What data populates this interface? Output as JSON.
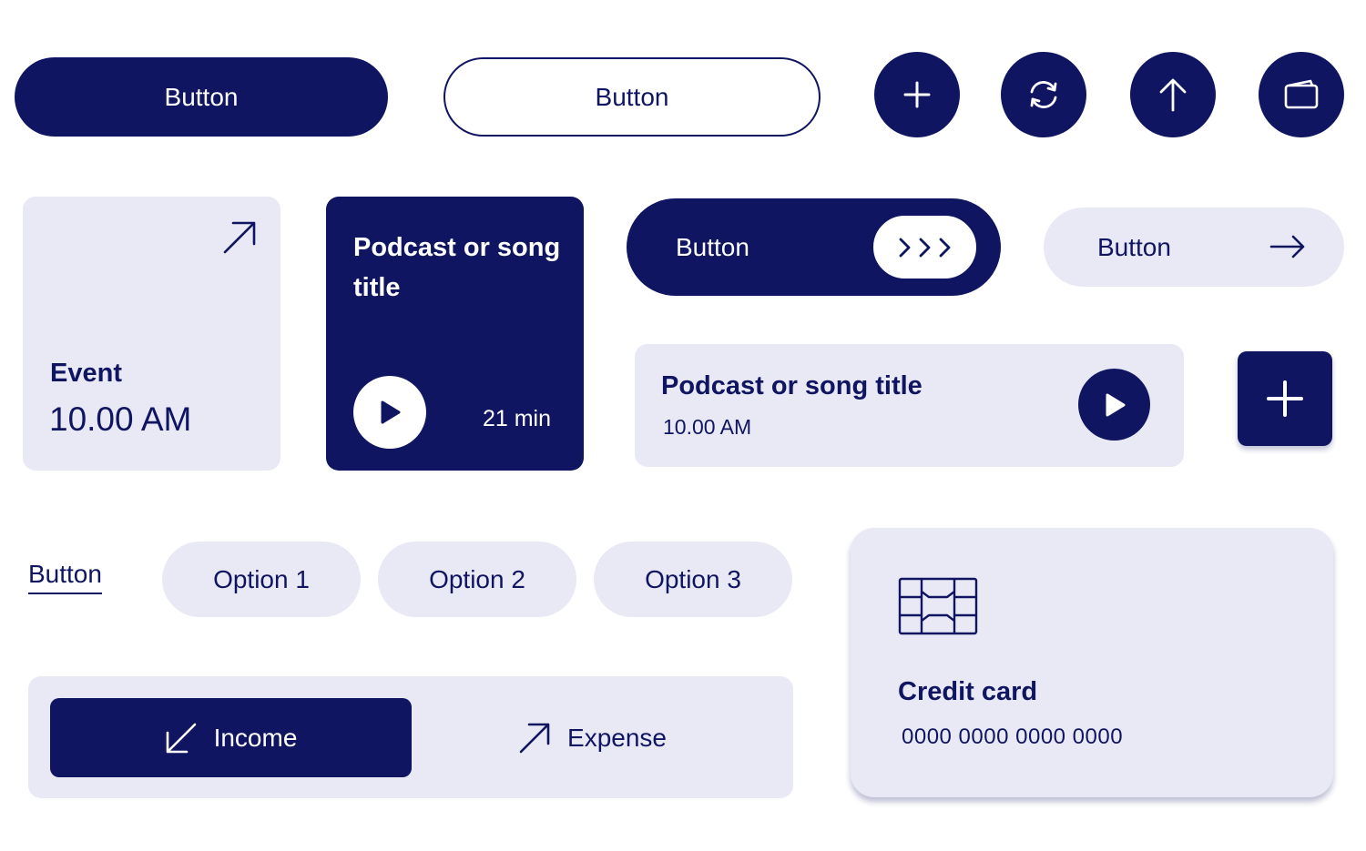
{
  "colors": {
    "primary": "#0f1560",
    "surface": "#e9e9f5",
    "white": "#ffffff"
  },
  "buttons": {
    "primary_label": "Button",
    "outline_label": "Button",
    "slide_label": "Button",
    "slide_handle": ">>>",
    "arrow_label": "Button",
    "text_link": "Button"
  },
  "icon_buttons": [
    "plus-icon",
    "refresh-icon",
    "arrow-up-icon",
    "wallet-icon"
  ],
  "event_card": {
    "label": "Event",
    "time": "10.00 AM",
    "icon": "arrow-up-right-icon"
  },
  "podcast_card": {
    "title": "Podcast or song title",
    "duration": "21 min",
    "icon": "play-icon"
  },
  "podcast_row": {
    "title": "Podcast or song title",
    "time": "10.00 AM",
    "icon": "play-icon"
  },
  "add_button": {
    "icon": "plus-icon"
  },
  "options": [
    "Option 1",
    "Option 2",
    "Option 3"
  ],
  "segmented": {
    "income": "Income",
    "expense": "Expense",
    "selected": "income"
  },
  "credit_card": {
    "title": "Credit card",
    "number": "0000 0000 0000 0000",
    "icon": "card-chip-icon"
  }
}
